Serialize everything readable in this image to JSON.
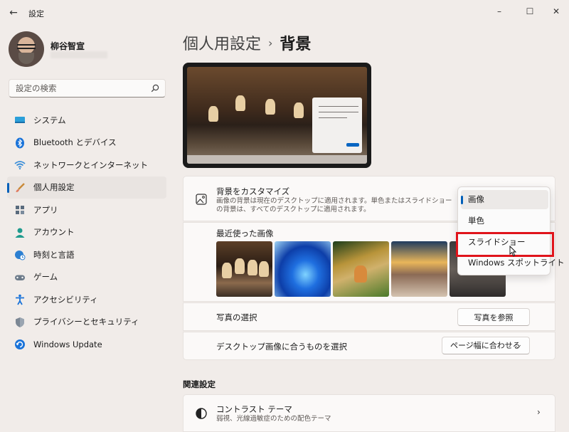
{
  "window": {
    "app_title": "設定",
    "back_icon": "arrow-left-icon",
    "controls": {
      "minimize": "–",
      "maximize": "☐",
      "close": "✕"
    }
  },
  "user": {
    "name": "柳谷智宣"
  },
  "search": {
    "placeholder": "設定の検索"
  },
  "nav": {
    "items": [
      {
        "label": "システム",
        "icon": "monitor-icon"
      },
      {
        "label": "Bluetooth とデバイス",
        "icon": "bluetooth-icon"
      },
      {
        "label": "ネットワークとインターネット",
        "icon": "wifi-icon"
      },
      {
        "label": "個人用設定",
        "icon": "brush-icon",
        "active": true
      },
      {
        "label": "アプリ",
        "icon": "apps-icon"
      },
      {
        "label": "アカウント",
        "icon": "account-icon"
      },
      {
        "label": "時刻と言語",
        "icon": "globe-clock-icon"
      },
      {
        "label": "ゲーム",
        "icon": "gamepad-icon"
      },
      {
        "label": "アクセシビリティ",
        "icon": "accessibility-icon"
      },
      {
        "label": "プライバシーとセキュリティ",
        "icon": "shield-icon"
      },
      {
        "label": "Windows Update",
        "icon": "update-icon"
      }
    ]
  },
  "breadcrumb": {
    "parent": "個人用設定",
    "separator": "›",
    "current": "背景"
  },
  "customize": {
    "title": "背景をカスタマイズ",
    "description": "画像の背景は現在のデスクトップに適用されます。単色またはスライドショーの背景は、すべてのデスクトップに適用されます。"
  },
  "recent": {
    "title": "最近使った画像"
  },
  "photo": {
    "title": "写真の選択",
    "button": "写真を参照"
  },
  "fit": {
    "title": "デスクトップ画像に合うものを選択",
    "value": "ページ幅に合わせる"
  },
  "dropdown": {
    "options": [
      "画像",
      "単色",
      "スライドショー",
      "Windows スポットライト"
    ],
    "selected": "画像",
    "highlighted": "スライドショー"
  },
  "related": {
    "title": "関連設定",
    "contrast_title": "コントラスト テーマ",
    "contrast_desc": "弱視、光線過敏症のための配色テーマ"
  },
  "colors": {
    "accent": "#005fb8",
    "highlight_border": "#e0141b",
    "background": "#f1ece9"
  }
}
